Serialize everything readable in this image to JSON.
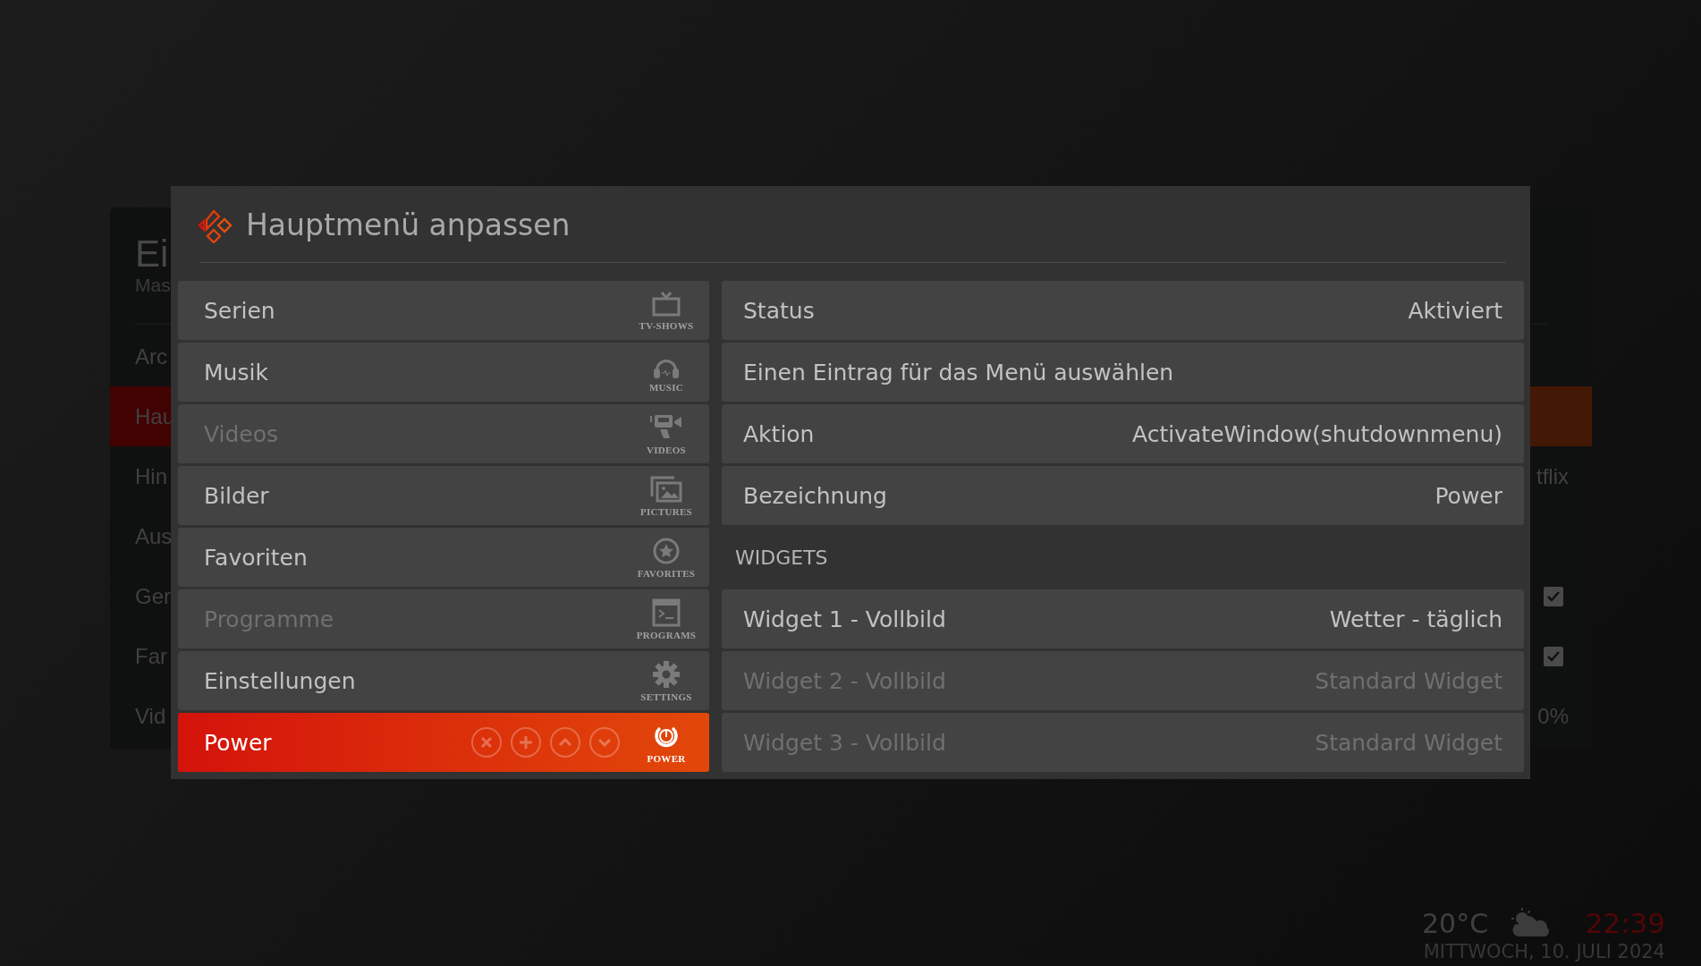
{
  "background_panel": {
    "title": "Ei",
    "subtitle": "Mas",
    "items": [
      {
        "label": "Arc",
        "selected": false
      },
      {
        "label": "Hau",
        "selected": true
      },
      {
        "label": "Hin",
        "selected": false,
        "value": "tflix"
      },
      {
        "label": "Aus",
        "selected": false
      },
      {
        "label": "Ger",
        "selected": false,
        "checked": true
      },
      {
        "label": "Far",
        "selected": false,
        "checked": true
      },
      {
        "label": "Vid",
        "selected": false,
        "value": "0%"
      }
    ]
  },
  "dialog": {
    "title": "Hauptmenü anpassen",
    "menu_items": [
      {
        "label": "Serien",
        "caption": "TV-SHOWS",
        "selected": false,
        "disabled": false
      },
      {
        "label": "Musik",
        "caption": "MUSIC",
        "selected": false,
        "disabled": false
      },
      {
        "label": "Videos",
        "caption": "VIDEOS",
        "selected": false,
        "disabled": true
      },
      {
        "label": "Bilder",
        "caption": "PICTURES",
        "selected": false,
        "disabled": false
      },
      {
        "label": "Favoriten",
        "caption": "FAVORITES",
        "selected": false,
        "disabled": false
      },
      {
        "label": "Programme",
        "caption": "PROGRAMS",
        "selected": false,
        "disabled": true
      },
      {
        "label": "Einstellungen",
        "caption": "SETTINGS",
        "selected": false,
        "disabled": false
      },
      {
        "label": "Power",
        "caption": "POWER",
        "selected": true,
        "disabled": false
      }
    ],
    "settings": [
      {
        "kind": "setting",
        "label": "Status",
        "value": "Aktiviert",
        "disabled": false
      },
      {
        "kind": "setting",
        "label": "Einen Eintrag für das Menü auswählen",
        "disabled": false
      },
      {
        "kind": "setting",
        "label": "Aktion",
        "value": "ActivateWindow(shutdownmenu)",
        "disabled": false
      },
      {
        "kind": "setting",
        "label": "Bezeichnung",
        "value": "Power",
        "disabled": false
      },
      {
        "kind": "heading",
        "label": "WIDGETS"
      },
      {
        "kind": "setting",
        "label": "Widget 1 - Vollbild",
        "value": "Wetter - täglich",
        "disabled": false
      },
      {
        "kind": "setting",
        "label": "Widget 2 - Vollbild",
        "value": "Standard Widget",
        "disabled": true
      },
      {
        "kind": "setting",
        "label": "Widget 3 - Vollbild",
        "value": "Standard Widget",
        "disabled": true
      }
    ]
  },
  "info": {
    "temperature": "20°C",
    "time": "22:39",
    "date": "MITTWOCH, 10. JULI 2024"
  }
}
